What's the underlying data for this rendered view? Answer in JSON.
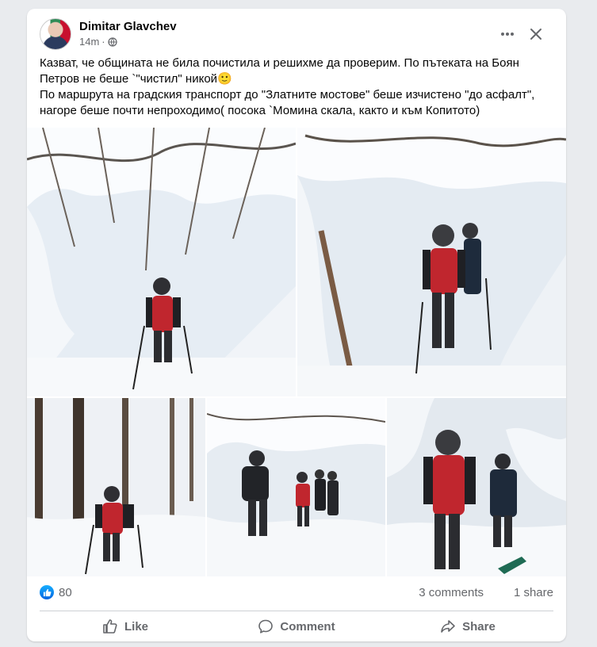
{
  "post": {
    "author": "Dimitar Glavchev",
    "time": "14m",
    "text_line1": "Казват, че общината не била почистила и решихме да проверим. По пътеката на Боян",
    "text_line2": "Петров не беше `\"чистил\" никой🙂",
    "text_line3": "По маршрута на градския транспорт до \"Златните мостове\" беше изчистено \"до асфалт\",",
    "text_line4": "нагоре беше почти непроходимо( посока `Момина скала, както и към Копитото)"
  },
  "stats": {
    "likes": "80",
    "comments": "3 comments",
    "shares": "1 share"
  },
  "actions": {
    "like": "Like",
    "comment": "Comment",
    "share": "Share"
  },
  "icons": {
    "more": "more-icon",
    "close": "close-icon",
    "privacy": "globe-icon",
    "like_badge": "thumbs-up-icon"
  },
  "colors": {
    "accent": "#0866ff",
    "jacket_red": "#c0262e",
    "muted_text": "#65676b"
  }
}
